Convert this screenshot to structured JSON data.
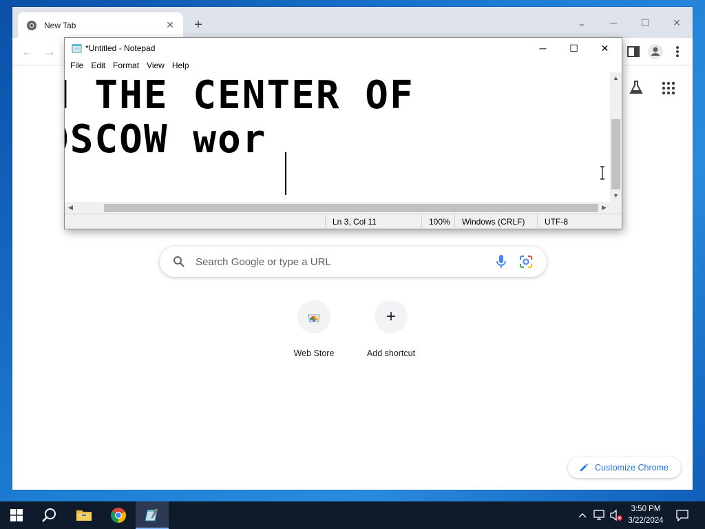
{
  "chrome": {
    "tab_title": "New Tab",
    "new_tab_symbol": "+",
    "search_placeholder": "Search Google or type a URL",
    "shortcuts": [
      {
        "label": "Web Store",
        "icon": "web-store-icon"
      },
      {
        "label": "Add shortcut",
        "icon": "plus-icon"
      }
    ],
    "customize_label": "Customize Chrome"
  },
  "notepad": {
    "title": "*Untitled - Notepad",
    "menu": [
      "File",
      "Edit",
      "Format",
      "View",
      "Help"
    ],
    "lines": [
      "N THE CENTER OF",
      "OSCOW wor"
    ],
    "status": {
      "position": "Ln 3, Col 11",
      "zoom": "100%",
      "line_ending": "Windows (CRLF)",
      "encoding": "UTF-8"
    }
  },
  "taskbar": {
    "time": "3:50 PM",
    "date": "3/22/2024",
    "apps": [
      "start-icon",
      "search-icon",
      "file-explorer-icon",
      "chrome-icon",
      "notepad-icon"
    ]
  },
  "colors": {
    "chrome_tabbar": "#dee3eb",
    "accent_blue": "#1a73e8",
    "taskbar": "#0f1a2b"
  }
}
